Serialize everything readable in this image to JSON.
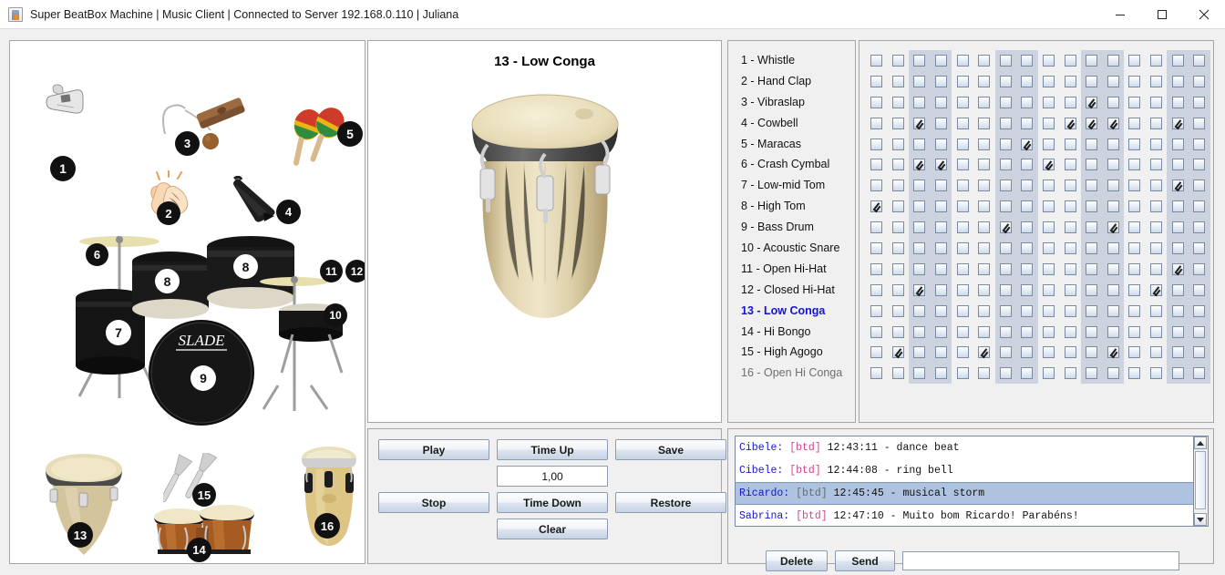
{
  "window": {
    "title": "Super BeatBox Machine | Music Client | Connected to Server 192.168.0.110 | Juliana",
    "icon": "java-coffee-cup-icon",
    "minimize_label": "–",
    "maximize_label": "□",
    "close_label": "✕"
  },
  "poster": {
    "caption": "instrument-reference-poster",
    "badges": [
      {
        "n": "1",
        "style": "dark"
      },
      {
        "n": "2",
        "style": "dark"
      },
      {
        "n": "3",
        "style": "dark"
      },
      {
        "n": "4",
        "style": "dark"
      },
      {
        "n": "5",
        "style": "dark"
      },
      {
        "n": "6",
        "style": "dark"
      },
      {
        "n": "7",
        "style": "light"
      },
      {
        "n": "8",
        "style": "light"
      },
      {
        "n": "8",
        "style": "light"
      },
      {
        "n": "9",
        "style": "light"
      },
      {
        "n": "10",
        "style": "dark"
      },
      {
        "n": "11",
        "style": "dark"
      },
      {
        "n": "12",
        "style": "dark"
      },
      {
        "n": "13",
        "style": "dark"
      },
      {
        "n": "14",
        "style": "dark"
      },
      {
        "n": "15",
        "style": "dark"
      },
      {
        "n": "16",
        "style": "dark"
      }
    ]
  },
  "preview": {
    "title": "13 - Low Conga",
    "art": "low-conga-drum"
  },
  "transport": {
    "play": "Play",
    "time_up": "Time Up",
    "save": "Save",
    "tempo_value": "1,00",
    "stop": "Stop",
    "time_down": "Time Down",
    "restore": "Restore",
    "clear": "Clear"
  },
  "instruments": [
    {
      "label": "1 - Whistle",
      "state": "normal"
    },
    {
      "label": "2 - Hand Clap",
      "state": "normal"
    },
    {
      "label": "3 - Vibraslap",
      "state": "normal"
    },
    {
      "label": "4 - Cowbell",
      "state": "normal"
    },
    {
      "label": "5 - Maracas",
      "state": "normal"
    },
    {
      "label": "6 - Crash Cymbal",
      "state": "normal"
    },
    {
      "label": "7 - Low-mid Tom",
      "state": "normal"
    },
    {
      "label": "8 - High Tom",
      "state": "normal"
    },
    {
      "label": "9 - Bass Drum",
      "state": "normal"
    },
    {
      "label": "10 - Acoustic Snare",
      "state": "normal"
    },
    {
      "label": "11 - Open Hi-Hat",
      "state": "normal"
    },
    {
      "label": "12 - Closed Hi-Hat",
      "state": "normal"
    },
    {
      "label": "13 - Low Conga",
      "state": "selected"
    },
    {
      "label": "14 - Hi Bongo",
      "state": "normal"
    },
    {
      "label": "15 - High Agogo",
      "state": "normal"
    },
    {
      "label": "16 - Open Hi Conga",
      "state": "disabled"
    }
  ],
  "grid": {
    "columns": 16,
    "rows": 16,
    "banded_columns": [
      3,
      4,
      7,
      8,
      11,
      12,
      15,
      16
    ],
    "checked": [
      [],
      [],
      [
        11
      ],
      [
        3,
        10,
        11,
        12,
        15
      ],
      [
        8
      ],
      [
        3,
        4,
        9
      ],
      [
        15
      ],
      [
        1
      ],
      [
        7,
        12
      ],
      [],
      [
        15
      ],
      [
        3,
        14
      ],
      [],
      [],
      [
        2,
        6,
        12
      ],
      []
    ]
  },
  "chat": {
    "messages": [
      {
        "who": "Cibele:",
        "tag": "[btd]",
        "body": "12:43:11 - dance beat",
        "selected": false
      },
      {
        "who": "Cibele:",
        "tag": "[btd]",
        "body": "12:44:08 - ring bell",
        "selected": false
      },
      {
        "who": "Ricardo:",
        "tag": "[btd]",
        "body": "12:45:45 - musical storm",
        "selected": true
      },
      {
        "who": "Sabrina:",
        "tag": "[btd]",
        "body": "12:47:10 - Muito bom Ricardo! Parabéns!",
        "selected": false
      }
    ],
    "delete_label": "Delete",
    "send_label": "Send",
    "input_value": "",
    "input_placeholder": ""
  },
  "colors": {
    "selected_instrument": "#1414cf",
    "chat_name": "#1414cf",
    "chat_tag": "#d2458e",
    "chat_selected_row": "#adc3e0",
    "grid_band": "#ccd3de",
    "window_bg": "#f0f0f0"
  }
}
